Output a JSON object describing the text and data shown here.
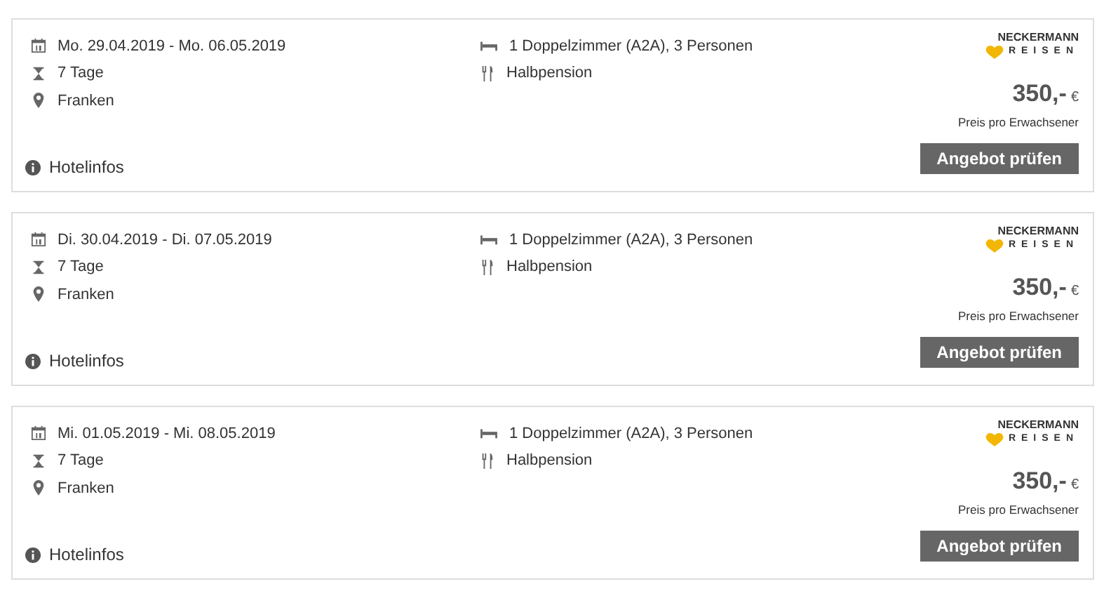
{
  "offers": [
    {
      "dates": "Mo. 29.04.2019 - Mo. 06.05.2019",
      "duration": "7 Tage",
      "region": "Franken",
      "room": "1 Doppelzimmer (A2A), 3 Personen",
      "board": "Halbpension",
      "brand_top": "NECKERMANN",
      "brand_bottom": "REISEN",
      "price": "350,-",
      "currency": "€",
      "price_note": "Preis pro Erwachsener",
      "info_link": "Hotelinfos",
      "button": "Angebot prüfen"
    },
    {
      "dates": "Di. 30.04.2019 - Di. 07.05.2019",
      "duration": "7 Tage",
      "region": "Franken",
      "room": "1 Doppelzimmer (A2A), 3 Personen",
      "board": "Halbpension",
      "brand_top": "NECKERMANN",
      "brand_bottom": "REISEN",
      "price": "350,-",
      "currency": "€",
      "price_note": "Preis pro Erwachsener",
      "info_link": "Hotelinfos",
      "button": "Angebot prüfen"
    },
    {
      "dates": "Mi. 01.05.2019 - Mi. 08.05.2019",
      "duration": "7 Tage",
      "region": "Franken",
      "room": "1 Doppelzimmer (A2A), 3 Personen",
      "board": "Halbpension",
      "brand_top": "NECKERMANN",
      "brand_bottom": "REISEN",
      "price": "350,-",
      "currency": "€",
      "price_note": "Preis pro Erwachsener",
      "info_link": "Hotelinfos",
      "button": "Angebot prüfen"
    }
  ]
}
